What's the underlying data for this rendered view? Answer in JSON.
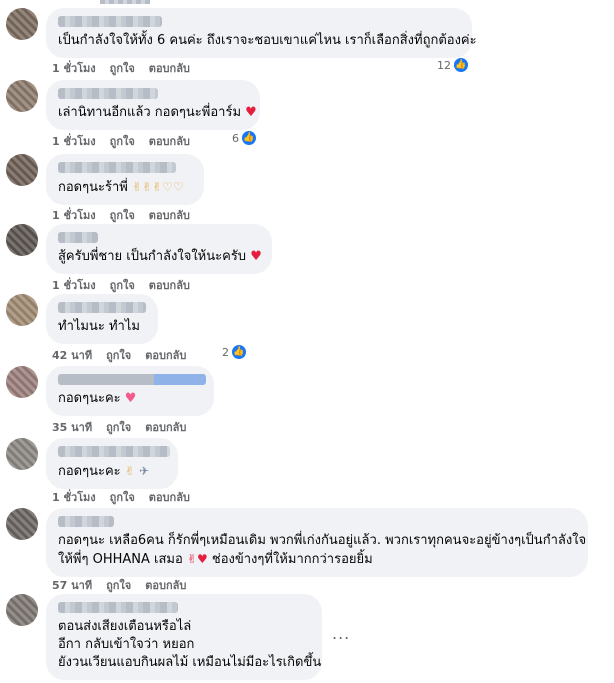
{
  "comments": [
    {
      "text": "เป็นกำลังใจให้ทั้ง 6 คนค่ะ ถึงเราจะชอบเขาแค่ไหน เราก็เลือกสิ่งที่ถูกต้องค่ะ",
      "time": "1 ชั่วโมง",
      "like": "ถูกใจ",
      "reply": "ตอบกลับ",
      "reaction_count": "12",
      "avatar_color": "#7a6a5d"
    },
    {
      "text": "เล่านิทานอีกแล้ว กอดๆนะพี่อาร์ม",
      "emoji": "♥",
      "time": "1 ชั่วโมง",
      "like": "ถูกใจ",
      "reply": "ตอบกลับ",
      "reaction_count": "6",
      "avatar_color": "#8b7a6a"
    },
    {
      "text": "กอดๆนะร้าพี่",
      "emoji": "✌✌✌♡♡",
      "time": "1 ชั่วโมง",
      "like": "ถูกใจ",
      "reply": "ตอบกลับ",
      "avatar_color": "#6e5f56"
    },
    {
      "text": "สู้ครับพี่ชาย เป็นกำลังใจให้นะครับ",
      "emoji": "♥",
      "time": "1 ชั่วโมง",
      "like": "ถูกใจ",
      "reply": "ตอบกลับ",
      "avatar_color": "#5c5450"
    },
    {
      "text": "ทำไมนะ ทำไม",
      "time": "42 นาที",
      "like": "ถูกใจ",
      "reply": "ตอบกลับ",
      "reaction_count": "2",
      "avatar_color": "#a08a72"
    },
    {
      "text": "กอดๆนะคะ",
      "emoji": "♥",
      "time": "35 นาที",
      "like": "ถูกใจ",
      "reply": "ตอบกลับ",
      "avatar_color": "#9a7e7a"
    },
    {
      "text": "กอดๆนะคะ",
      "emoji": "✌",
      "time": "1 ชั่วโมง",
      "like": "ถูกใจ",
      "reply": "ตอบกลับ",
      "avatar_color": "#8a8580"
    },
    {
      "text_line1": "กอดๆนะ เหลือ6คน ก็รักพี่ๆเหมือนเดิม พวกพี่เก่งกันอยู่แล้ว. พวกเราทุกคนจะอยู่ข้างๆเป็นกำลังใจ",
      "text_line2": "ให้พี่ๆ OHHANA เสมอ",
      "text_line2_end": "ช่องข้างๆที่ให้มากกว่ารอยยิ้ม",
      "emoji": "✌♥",
      "time": "57 นาที",
      "like": "ถูกใจ",
      "reply": "ตอบกลับ",
      "avatar_color": "#6a6461"
    },
    {
      "text_line1": "ตอนส่งเสียงเตือนหรือไล่",
      "text_line2": "อีกา กลับเข้าใจว่า หยอก",
      "text_line3": "ยังวนเวียนแอบกินผลไม้ เหมือนไม่มีอะไรเกิดขึ้น",
      "more": "...",
      "avatar_color": "#7d7570"
    }
  ],
  "like_icon": "thumbs-up-icon"
}
